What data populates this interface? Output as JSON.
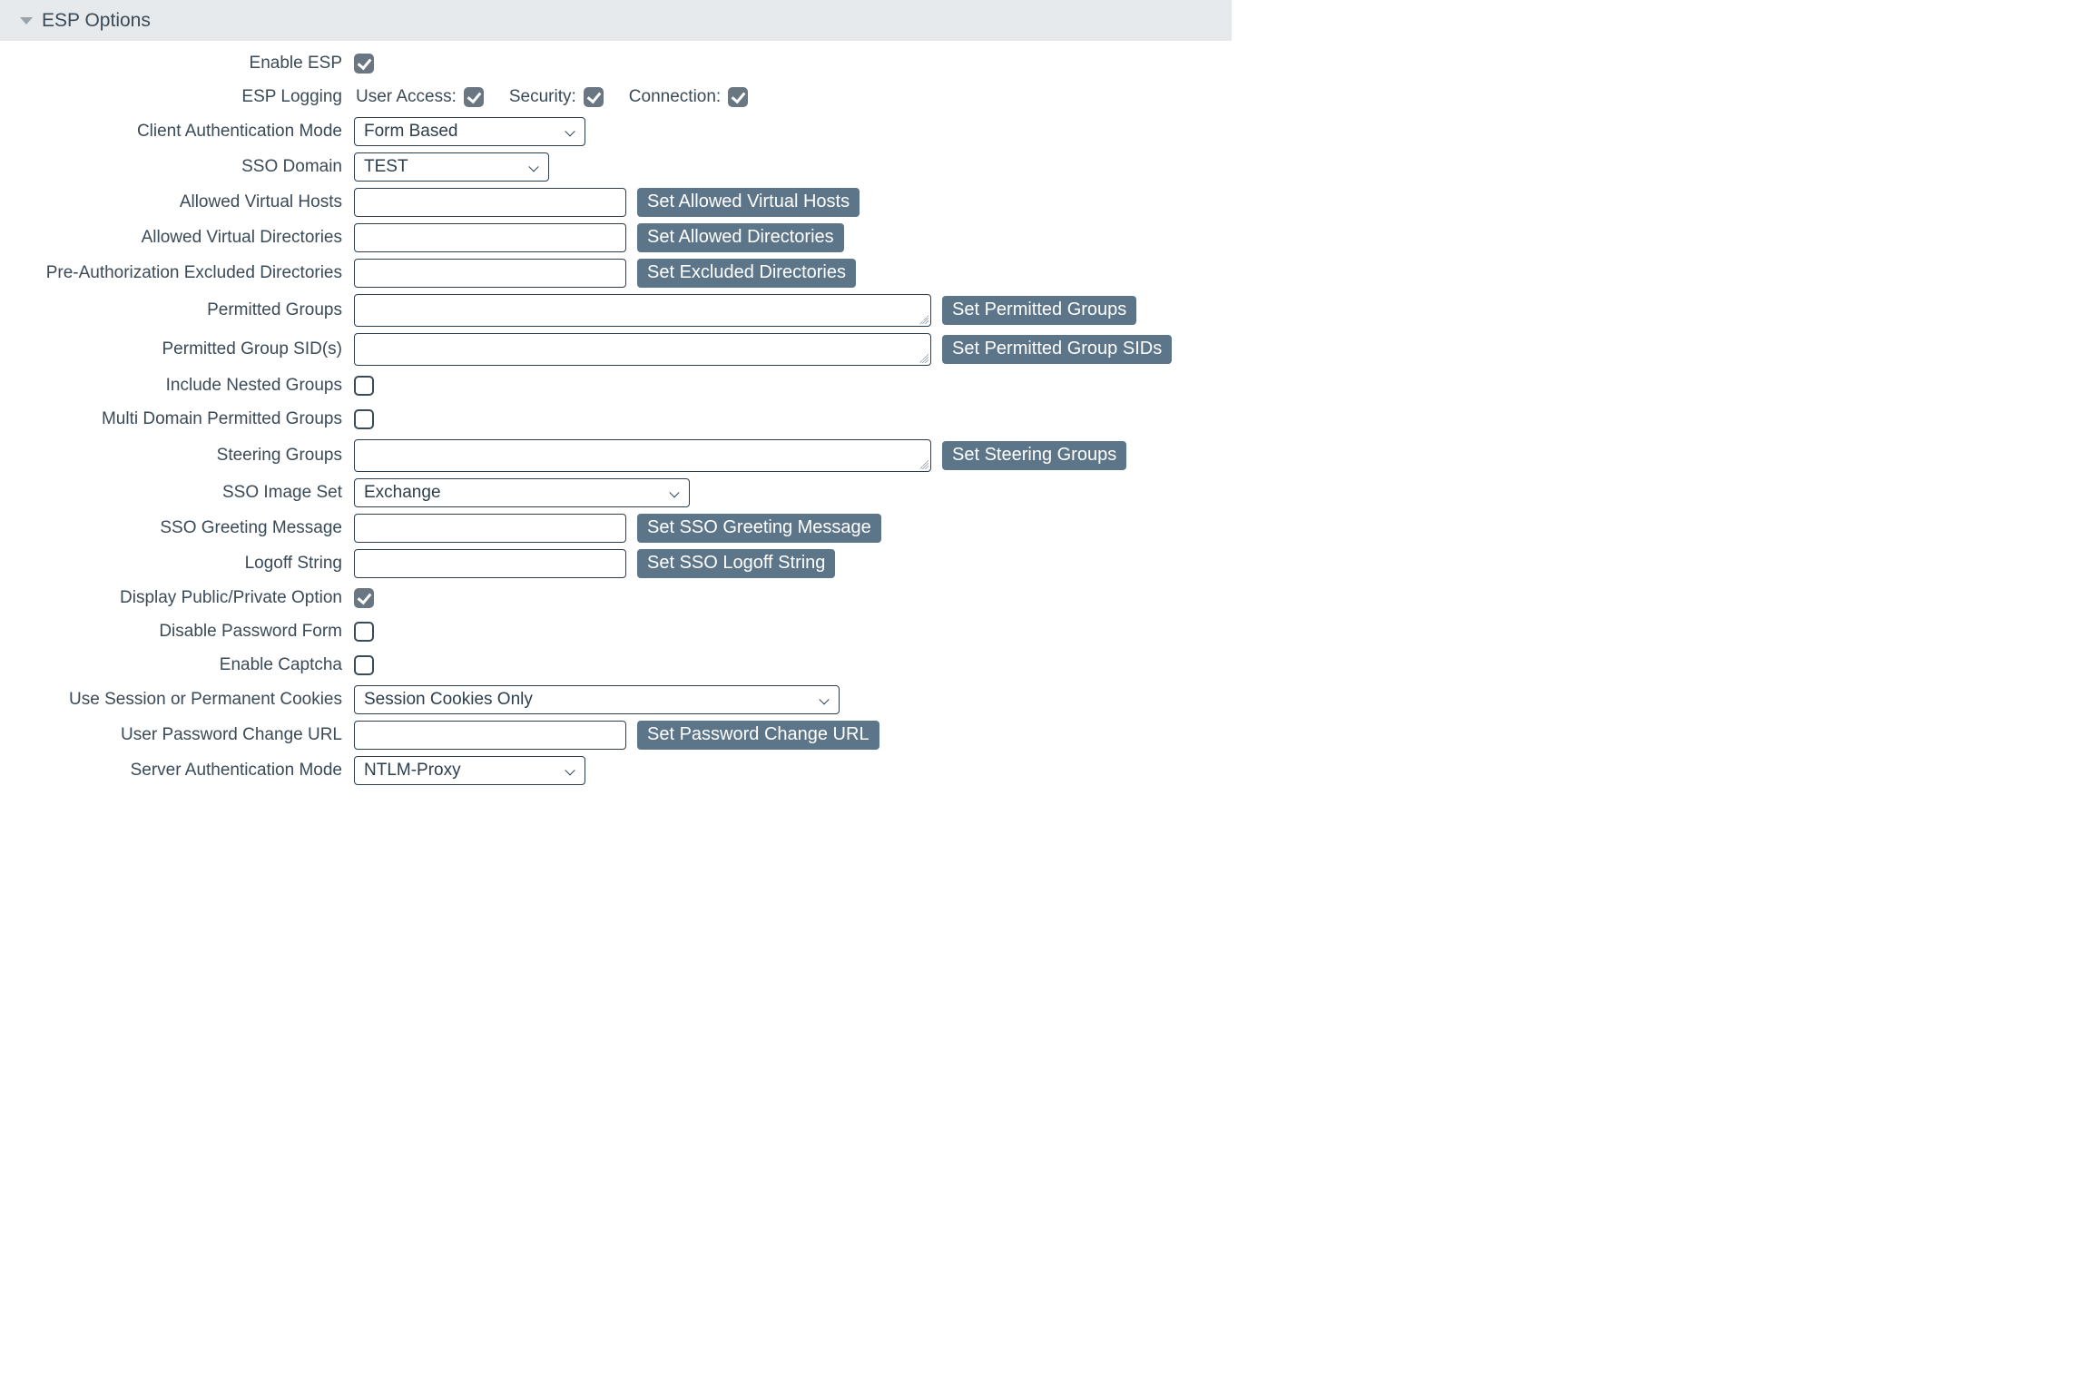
{
  "panelTitle": "ESP Options",
  "rows": {
    "enableESP": {
      "label": "Enable ESP",
      "checked": true
    },
    "espLogging": {
      "label": "ESP Logging",
      "userAccess": {
        "label": "User Access:",
        "checked": true
      },
      "security": {
        "label": "Security:",
        "checked": true
      },
      "connection": {
        "label": "Connection:",
        "checked": true
      }
    },
    "clientAuthMode": {
      "label": "Client Authentication Mode",
      "value": "Form Based"
    },
    "ssoDomain": {
      "label": "SSO Domain",
      "value": "TEST"
    },
    "allowedVHosts": {
      "label": "Allowed Virtual Hosts",
      "value": "",
      "button": "Set Allowed Virtual Hosts"
    },
    "allowedVDirs": {
      "label": "Allowed Virtual Directories",
      "value": "",
      "button": "Set Allowed Directories"
    },
    "preAuthExcl": {
      "label": "Pre-Authorization Excluded Directories",
      "value": "",
      "button": "Set Excluded Directories"
    },
    "permGroups": {
      "label": "Permitted Groups",
      "value": "",
      "button": "Set Permitted Groups"
    },
    "permGroupSIDs": {
      "label": "Permitted Group SID(s)",
      "value": "",
      "button": "Set Permitted Group SIDs"
    },
    "inclNested": {
      "label": "Include Nested Groups",
      "checked": false
    },
    "multiDomainPG": {
      "label": "Multi Domain Permitted Groups",
      "checked": false
    },
    "steeringGroups": {
      "label": "Steering Groups",
      "value": "",
      "button": "Set Steering Groups"
    },
    "ssoImageSet": {
      "label": "SSO Image Set",
      "value": "Exchange"
    },
    "ssoGreeting": {
      "label": "SSO Greeting Message",
      "value": "",
      "button": "Set SSO Greeting Message"
    },
    "logoffString": {
      "label": "Logoff String",
      "value": "",
      "button": "Set SSO Logoff String"
    },
    "displayPPO": {
      "label": "Display Public/Private Option",
      "checked": true
    },
    "disablePwdForm": {
      "label": "Disable Password Form",
      "checked": false
    },
    "enableCaptcha": {
      "label": "Enable Captcha",
      "checked": false
    },
    "cookies": {
      "label": "Use Session or Permanent Cookies",
      "value": "Session Cookies Only"
    },
    "pwdChangeURL": {
      "label": "User Password Change URL",
      "value": "",
      "button": "Set Password Change URL"
    },
    "serverAuthMode": {
      "label": "Server Authentication Mode",
      "value": "NTLM-Proxy"
    }
  }
}
